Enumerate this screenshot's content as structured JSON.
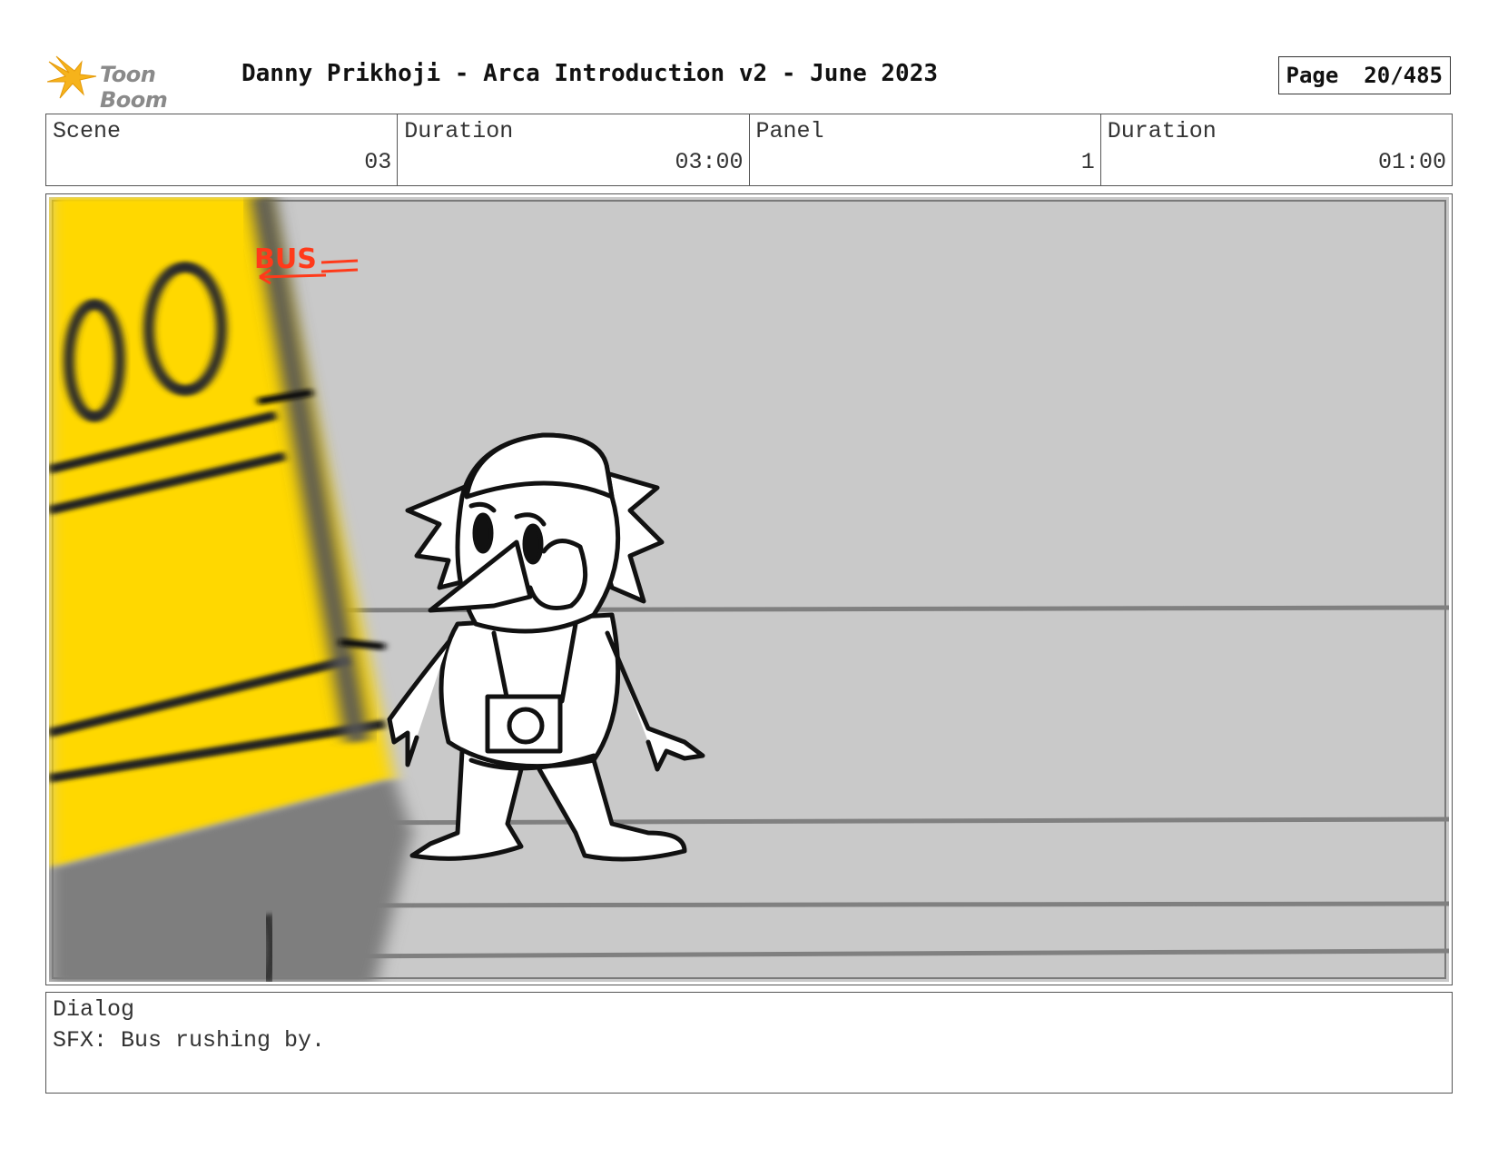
{
  "header": {
    "logo_text": "Toon Boom",
    "title": "Danny Prikhoji - Arca Introduction v2 - June 2023",
    "page_label": "Page",
    "page_value": "20/485"
  },
  "info": {
    "scene_label": "Scene",
    "scene_value": "03",
    "scene_duration_label": "Duration",
    "scene_duration_value": "03:00",
    "panel_label": "Panel",
    "panel_value": "1",
    "panel_duration_label": "Duration",
    "panel_duration_value": "01:00"
  },
  "panel": {
    "annotation": "BUS",
    "colors": {
      "background": "#c9c9c9",
      "bus": "#ffd800",
      "annotation": "#ff3a1a"
    }
  },
  "dialog": {
    "label": "Dialog",
    "text": "SFX: Bus rushing by."
  }
}
